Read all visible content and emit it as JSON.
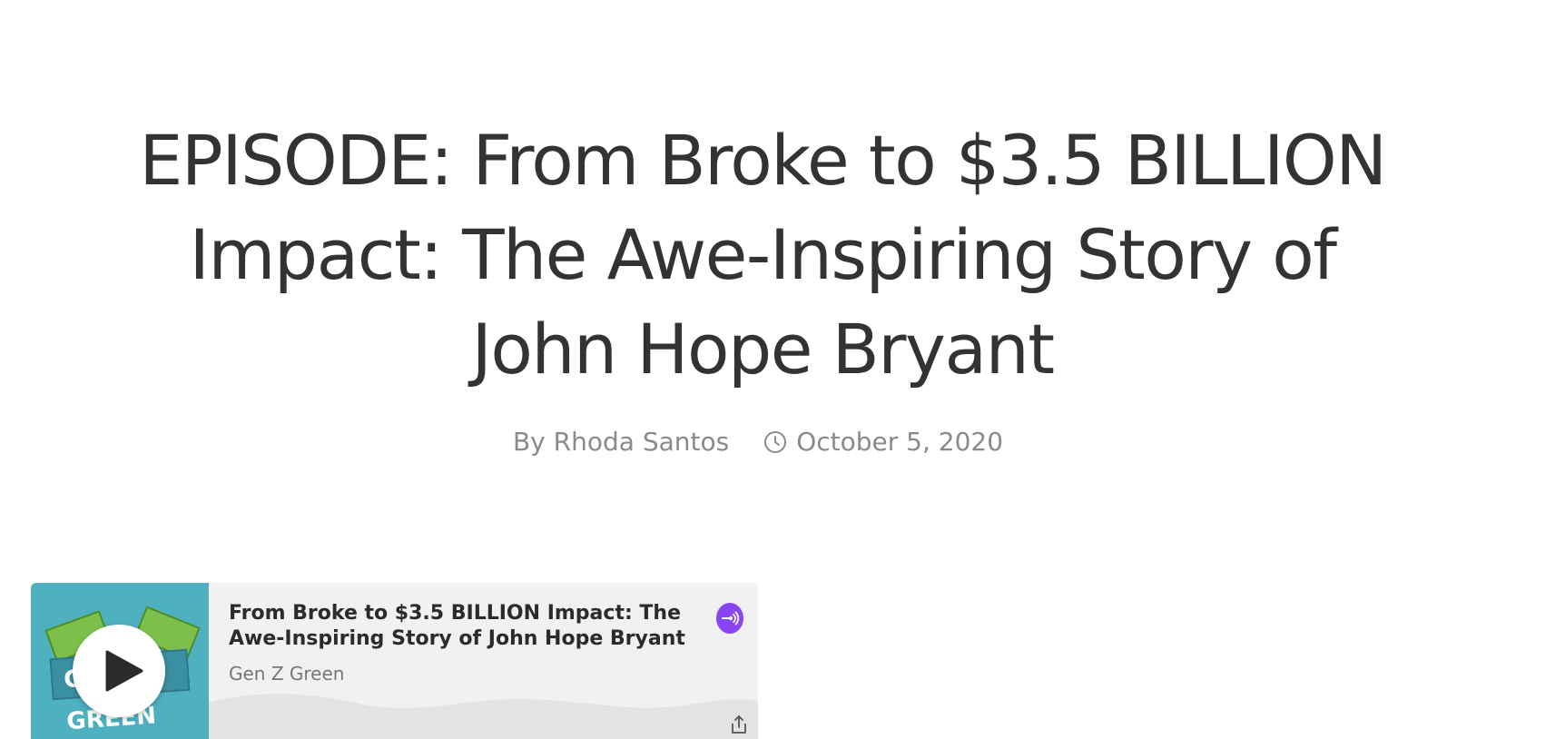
{
  "post": {
    "title": "EPISODE: From Broke to $3.5 BILLION Impact: The Awe-Inspiring Story of John Hope Bryant",
    "author_line": "By Rhoda Santos",
    "date": "October 5, 2020"
  },
  "player": {
    "track_title": "From Broke to $3.5 BILLION Impact: The Awe-Inspiring Story of John Hope Bryant",
    "show_name": "Gen Z Green",
    "cover_text": "GEN Z GREEN",
    "icons": {
      "play": "play-icon",
      "logo": "anchor-logo-icon",
      "share": "share-icon",
      "clock": "clock-icon"
    },
    "colors": {
      "cover": "#4fb0c0",
      "logo": "#8a45f2"
    }
  }
}
